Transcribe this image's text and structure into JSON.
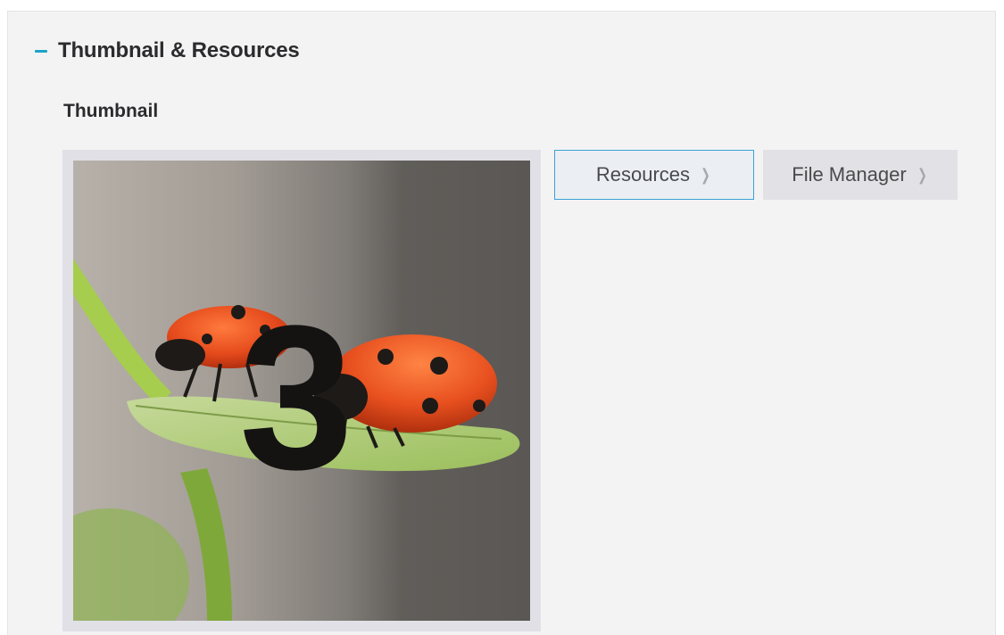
{
  "section": {
    "title": "Thumbnail & Resources",
    "collapse_icon": "minus-icon",
    "accent_color": "#1ba3c6"
  },
  "thumbnail": {
    "heading": "Thumbnail",
    "overlay_text": "3"
  },
  "buttons": {
    "resources_label": "Resources",
    "file_manager_label": "File Manager",
    "chevron_icon": "chevron-right-icon",
    "chevron_glyph": "❯"
  }
}
